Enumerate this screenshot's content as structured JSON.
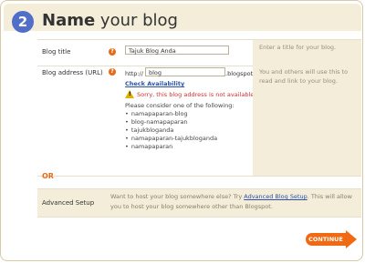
{
  "header": {
    "step": "2",
    "title_bold": "Name",
    "title_rest": "your blog"
  },
  "blog_title": {
    "label": "Blog title",
    "value": "Tajuk Blog Anda",
    "help": "Enter a title for your blog."
  },
  "blog_address": {
    "label": "Blog address (URL)",
    "prefix": "http://",
    "value": "blog",
    "suffix": ".blogspot.com",
    "check_link": "Check Availability",
    "error": "Sorry, this blog address is not available",
    "suggest_intro": "Please consider one of the following:",
    "suggestions": [
      "namapaparan-blog",
      "blog-namapaparan",
      "tajukbloganda",
      "namapaparan-tajukbloganda",
      "namapaparan"
    ],
    "help": "You and others will use this to read and link to your blog."
  },
  "or_label": "OR",
  "advanced": {
    "label": "Advanced Setup",
    "text_before": "Want to host your blog somewhere else? Try ",
    "link": "Advanced Blog Setup",
    "text_after": ". This will allow you to host your blog somewhere other than Blogspot."
  },
  "continue_label": "CONTINUE",
  "colors": {
    "accent": "#f06a14",
    "step_badge": "#4f6fc8",
    "panel": "#f3edd9",
    "link": "#2b51a8",
    "error": "#cc3333"
  },
  "icons": {
    "help": "question-mark-icon",
    "warning": "warning-icon",
    "continue": "arrow-right-icon"
  }
}
